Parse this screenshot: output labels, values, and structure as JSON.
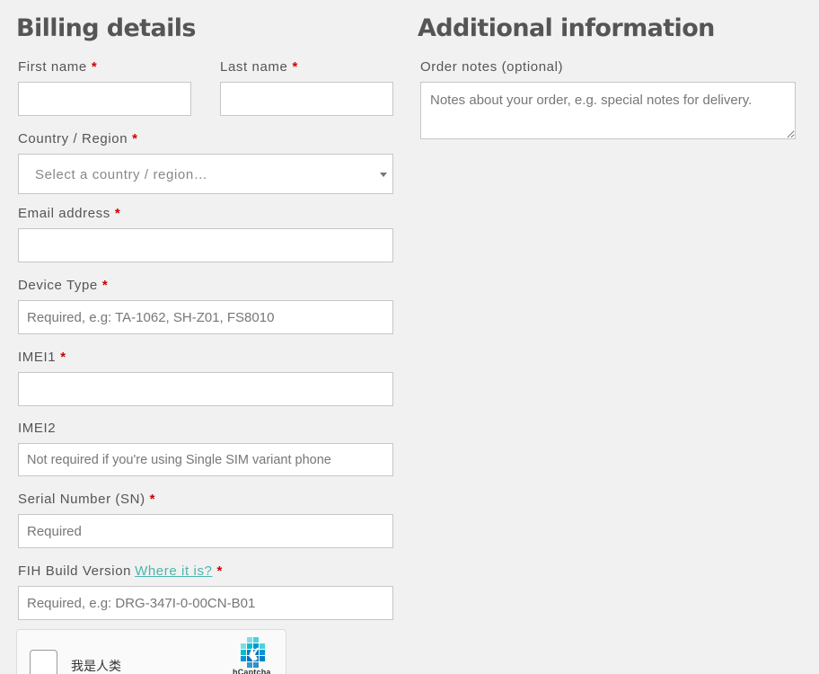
{
  "billing": {
    "title": "Billing details",
    "first_name_label": "First name",
    "last_name_label": "Last name",
    "country_label": "Country / Region",
    "country_placeholder": "Select a country / region…",
    "email_label": "Email address",
    "device_type_label": "Device Type",
    "device_type_placeholder": "Required, e.g: TA-1062, SH-Z01, FS8010",
    "imei1_label": "IMEI1",
    "imei2_label": "IMEI2",
    "imei2_placeholder": "Not required if you're using Single SIM variant phone",
    "sn_label": "Serial Number (SN)",
    "sn_placeholder": "Required",
    "build_label": "FIH Build Version",
    "build_link": "Where it is?",
    "build_placeholder": "Required, e.g: DRG-347I-0-00CN-B01",
    "required_mark": "*"
  },
  "additional": {
    "title": "Additional information",
    "notes_label": "Order notes (optional)",
    "notes_placeholder": "Notes about your order, e.g. special notes for delivery."
  },
  "captcha": {
    "label": "我是人类",
    "brand": "hCaptcha",
    "logo_icon": "hcaptcha-logo-icon",
    "accent": "#0074bf",
    "accent_light": "#00bfcf"
  },
  "colors": {
    "required": "#cc0000",
    "link": "#4cb5ab",
    "background": "#f1f1f1"
  }
}
